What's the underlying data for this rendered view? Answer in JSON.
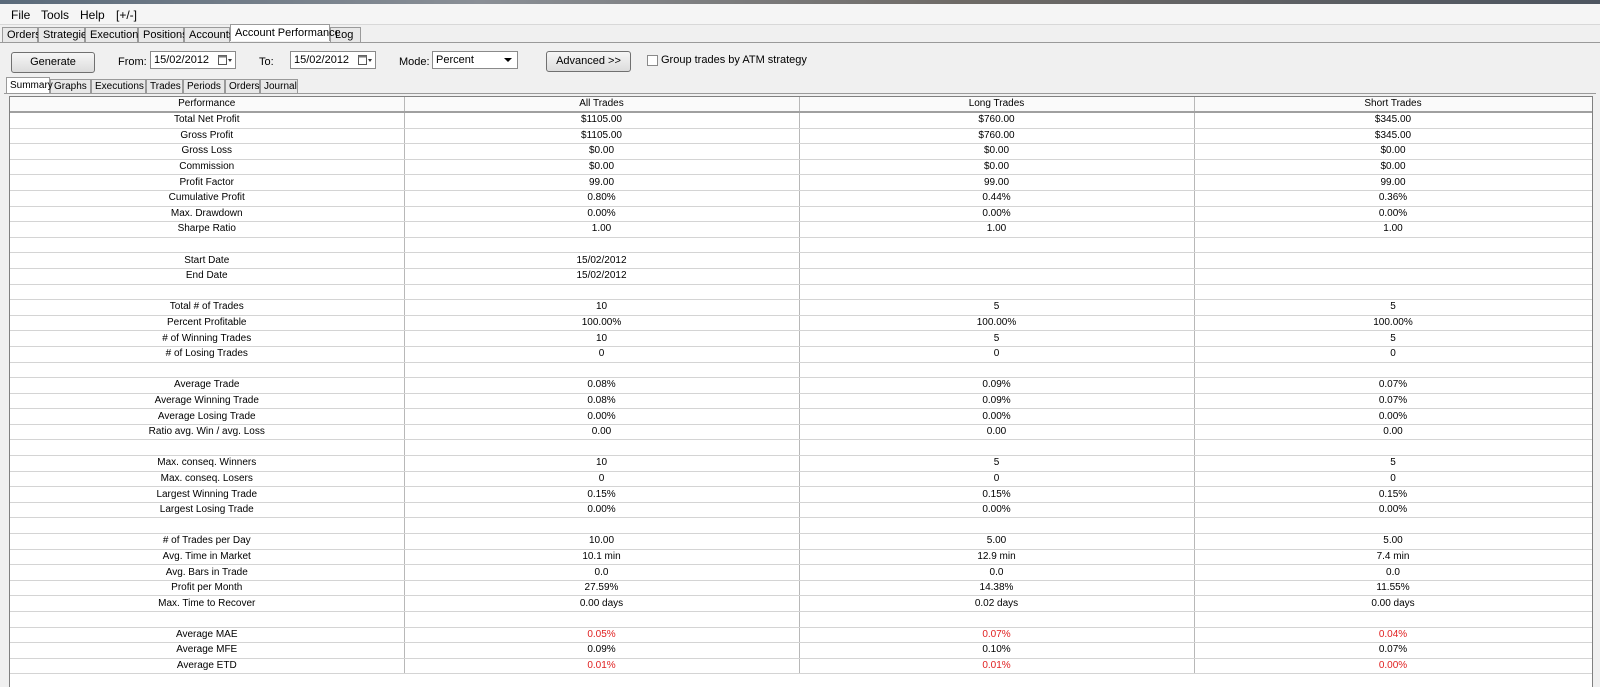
{
  "menu": [
    "File",
    "Tools",
    "Help",
    "[+/-]"
  ],
  "main_tabs": [
    "Orders",
    "Strategies",
    "Executions",
    "Positions",
    "Accounts",
    "Account Performance",
    "Log"
  ],
  "main_tab_active": "Account Performance",
  "toolbar": {
    "generate_label": "Generate",
    "from_label": "From:",
    "from_value": "15/02/2012",
    "to_label": "To:",
    "to_value": "15/02/2012",
    "mode_label": "Mode:",
    "mode_value": "Percent",
    "advanced_label": "Advanced >>",
    "group_label": "Group trades by ATM strategy",
    "group_checked": false
  },
  "sub_tabs": [
    "Summary",
    "Graphs",
    "Executions",
    "Trades",
    "Periods",
    "Orders",
    "Journal"
  ],
  "sub_tab_active": "Summary",
  "table": {
    "headers": [
      "Performance",
      "All Trades",
      "Long Trades",
      "Short Trades"
    ],
    "rows": [
      [
        "Total Net Profit",
        "$1105.00",
        "$760.00",
        "$345.00"
      ],
      [
        "Gross Profit",
        "$1105.00",
        "$760.00",
        "$345.00"
      ],
      [
        "Gross Loss",
        "$0.00",
        "$0.00",
        "$0.00"
      ],
      [
        "Commission",
        "$0.00",
        "$0.00",
        "$0.00"
      ],
      [
        "Profit Factor",
        "99.00",
        "99.00",
        "99.00"
      ],
      [
        "Cumulative Profit",
        "0.80%",
        "0.44%",
        "0.36%"
      ],
      [
        "Max. Drawdown",
        "0.00%",
        "0.00%",
        "0.00%"
      ],
      [
        "Sharpe Ratio",
        "1.00",
        "1.00",
        "1.00"
      ],
      [
        "",
        "",
        "",
        ""
      ],
      [
        "Start Date",
        "15/02/2012",
        "",
        ""
      ],
      [
        "End Date",
        "15/02/2012",
        "",
        ""
      ],
      [
        "",
        "",
        "",
        ""
      ],
      [
        "Total # of Trades",
        "10",
        "5",
        "5"
      ],
      [
        "Percent Profitable",
        "100.00%",
        "100.00%",
        "100.00%"
      ],
      [
        "# of Winning Trades",
        "10",
        "5",
        "5"
      ],
      [
        "# of Losing Trades",
        "0",
        "0",
        "0"
      ],
      [
        "",
        "",
        "",
        ""
      ],
      [
        "Average Trade",
        "0.08%",
        "0.09%",
        "0.07%"
      ],
      [
        "Average Winning Trade",
        "0.08%",
        "0.09%",
        "0.07%"
      ],
      [
        "Average Losing Trade",
        "0.00%",
        "0.00%",
        "0.00%"
      ],
      [
        "Ratio avg. Win / avg. Loss",
        "0.00",
        "0.00",
        "0.00"
      ],
      [
        "",
        "",
        "",
        ""
      ],
      [
        "Max. conseq. Winners",
        "10",
        "5",
        "5"
      ],
      [
        "Max. conseq. Losers",
        "0",
        "0",
        "0"
      ],
      [
        "Largest Winning Trade",
        "0.15%",
        "0.15%",
        "0.15%"
      ],
      [
        "Largest Losing Trade",
        "0.00%",
        "0.00%",
        "0.00%"
      ],
      [
        "",
        "",
        "",
        ""
      ],
      [
        "# of Trades per Day",
        "10.00",
        "5.00",
        "5.00"
      ],
      [
        "Avg. Time in Market",
        "10.1 min",
        "12.9 min",
        "7.4 min"
      ],
      [
        "Avg. Bars in Trade",
        "0.0",
        "0.0",
        "0.0"
      ],
      [
        "Profit per Month",
        "27.59%",
        "14.38%",
        "11.55%"
      ],
      [
        "Max. Time to Recover",
        "0.00 days",
        "0.02 days",
        "0.00 days"
      ],
      [
        "",
        "",
        "",
        ""
      ],
      [
        "Average MAE",
        "0.05%",
        "0.07%",
        "0.04%"
      ],
      [
        "Average MFE",
        "0.09%",
        "0.10%",
        "0.07%"
      ],
      [
        "Average ETD",
        "0.01%",
        "0.01%",
        "0.00%"
      ]
    ],
    "red_rows": [
      "Average MAE",
      "Average ETD"
    ]
  },
  "colors": {
    "negative_value": "#e02020",
    "grid_border": "#b8b8b8"
  }
}
